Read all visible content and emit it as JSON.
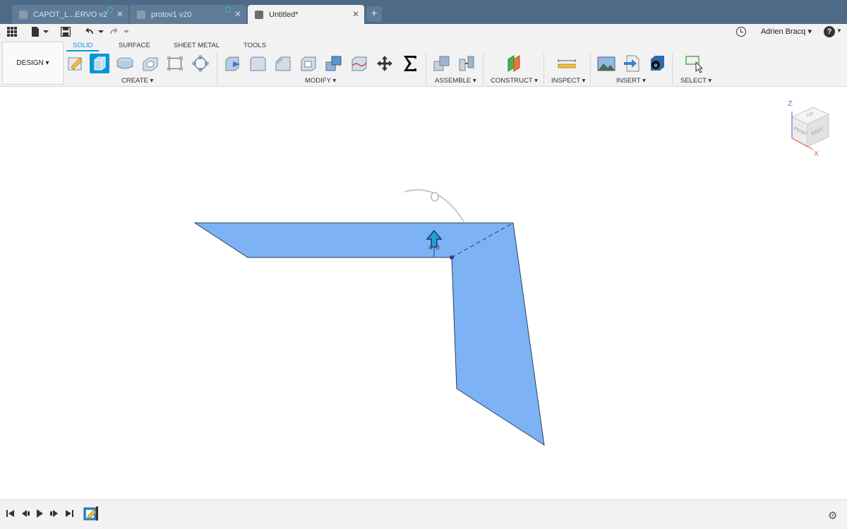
{
  "tabs": [
    {
      "label": "CAPOT_L...ERVO v2",
      "active": false,
      "synced": true
    },
    {
      "label": "protov1 v20",
      "active": false,
      "synced": true
    },
    {
      "label": "Untitled*",
      "active": true,
      "synced": false
    }
  ],
  "new_tab_label": "+",
  "user": {
    "name": "Adrien Bracq"
  },
  "workspace": {
    "label": "DESIGN"
  },
  "ribbon_tabs": [
    "SOLID",
    "SURFACE",
    "SHEET METAL",
    "TOOLS"
  ],
  "active_ribbon_tab": "SOLID",
  "groups": {
    "create": "CREATE",
    "modify": "MODIFY",
    "assemble": "ASSEMBLE",
    "construct": "CONSTRUCT",
    "inspect": "INSPECT",
    "insert": "INSERT",
    "select": "SELECT"
  },
  "canvas": {
    "manipulator_value": "4.0"
  },
  "viewcube": {
    "faces": {
      "top": "TOP",
      "front": "FRONT",
      "right": "RIGHT"
    },
    "axes": {
      "z": "Z",
      "x": "X"
    }
  },
  "colors": {
    "accent": "#0696d7",
    "tabbar": "#4e6a87",
    "profile_fill": "#7db3f5",
    "ribbon_bg": "#f2f2f2"
  }
}
